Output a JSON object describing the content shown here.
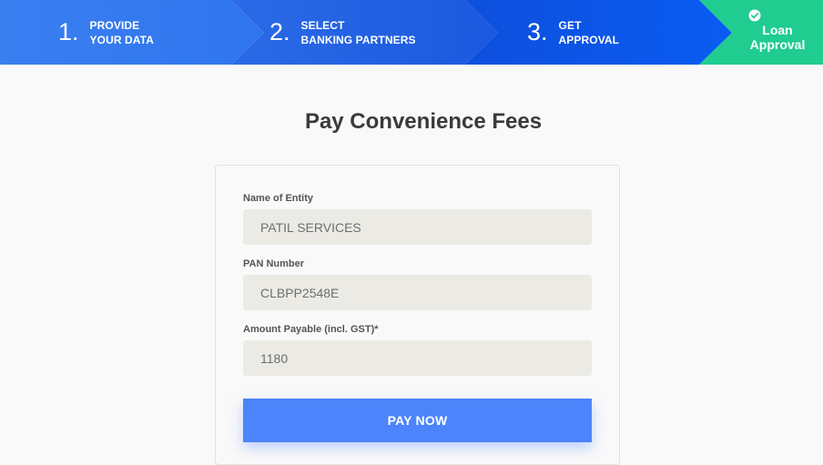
{
  "steps": [
    {
      "number": "1.",
      "line1": "PROVIDE",
      "line2": "YOUR DATA"
    },
    {
      "number": "2.",
      "line1": "SELECT",
      "line2": "BANKING PARTNERS"
    },
    {
      "number": "3.",
      "line1": "GET",
      "line2": "APPROVAL"
    }
  ],
  "final_step": {
    "line1": "Loan",
    "line2": "Approval",
    "icon": "check-circle-icon"
  },
  "colors": {
    "step1": "#3a7ff0",
    "step2": "#1f61e2",
    "step3": "#0c56ec",
    "final": "#21cc90",
    "button": "#4c84fb",
    "input_bg": "#ebeae4"
  },
  "page": {
    "title": "Pay Convenience Fees"
  },
  "form": {
    "entity": {
      "label": "Name of Entity",
      "value": "PATIL SERVICES"
    },
    "pan": {
      "label": "PAN Number",
      "value": "CLBPP2548E"
    },
    "amount": {
      "label": "Amount Payable (incl. GST)*",
      "value": "1180"
    },
    "submit_label": "PAY NOW"
  }
}
